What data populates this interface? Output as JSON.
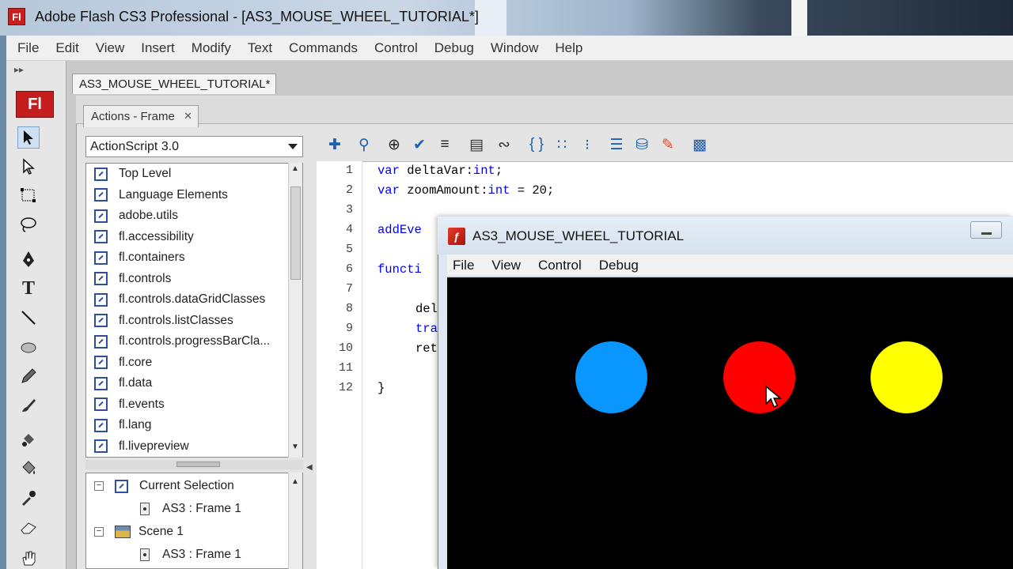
{
  "window": {
    "title": "Adobe Flash CS3 Professional - [AS3_MOUSE_WHEEL_TUTORIAL*]",
    "logo": "Fl"
  },
  "menu": [
    "File",
    "Edit",
    "View",
    "Insert",
    "Modify",
    "Text",
    "Commands",
    "Control",
    "Debug",
    "Window",
    "Help"
  ],
  "document_tab": "AS3_MOUSE_WHEEL_TUTORIAL*",
  "toolbox": {
    "badge": "Fl",
    "tools": [
      "selection-arrow-icon",
      "subselection-arrow-icon",
      "free-transform-icon",
      "lasso-icon",
      "pen-icon",
      "text-tool-icon",
      "line-tool-icon",
      "oval-tool-icon",
      "pencil-icon",
      "brush-icon",
      "ink-bottle-icon",
      "paint-bucket-icon",
      "eyedropper-icon",
      "eraser-icon",
      "hand-icon"
    ],
    "text_tool_glyph": "T"
  },
  "actions": {
    "tab_label": "Actions - Frame",
    "language": "ActionScript 3.0",
    "tree_items": [
      "Top Level",
      "Language Elements",
      "adobe.utils",
      "fl.accessibility",
      "fl.containers",
      "fl.controls",
      "fl.controls.dataGridClasses",
      "fl.controls.listClasses",
      "fl.controls.progressBarCla...",
      "fl.core",
      "fl.data",
      "fl.events",
      "fl.lang",
      "fl.livepreview"
    ],
    "lower_tree": {
      "current_selection": "Current Selection",
      "current_frame": "AS3 : Frame 1",
      "scene": "Scene 1",
      "scene_frame": "AS3 : Frame 1"
    }
  },
  "code_toolbar_icons": [
    "add-item-icon",
    "find-icon",
    "target-path-icon",
    "check-syntax-icon",
    "auto-format-icon",
    "code-hint-icon",
    "debug-options-icon",
    "collapse-between-braces-icon",
    "collapse-selection-icon",
    "expand-all-icon",
    "apply-block-comment-icon",
    "apply-line-comment-icon",
    "remove-comment-icon",
    "show-hide-toolbox-icon"
  ],
  "code": {
    "line_numbers": [
      "1",
      "2",
      "3",
      "4",
      "5",
      "6",
      "7",
      "8",
      "9",
      "10",
      "11",
      "12"
    ],
    "line1_kw1": "var",
    "line1_text": " deltaVar:",
    "line1_kw2": "int",
    "line1_end": ";",
    "line2_kw1": "var",
    "line2_text": " zoomAmount:",
    "line2_kw2": "int",
    "line2_end": " = 20;",
    "line4": "addEve",
    "line6": "functi",
    "line8": "del",
    "line9": "tra",
    "line10": "ret",
    "line12": "}"
  },
  "player": {
    "title": "AS3_MOUSE_WHEEL_TUTORIAL",
    "menu": [
      "File",
      "View",
      "Control",
      "Debug"
    ],
    "stage_color": "#000000",
    "circles": [
      {
        "name": "blue",
        "color": "#0a96ff"
      },
      {
        "name": "red",
        "color": "#ff0000"
      },
      {
        "name": "yellow",
        "color": "#ffff00"
      }
    ]
  }
}
